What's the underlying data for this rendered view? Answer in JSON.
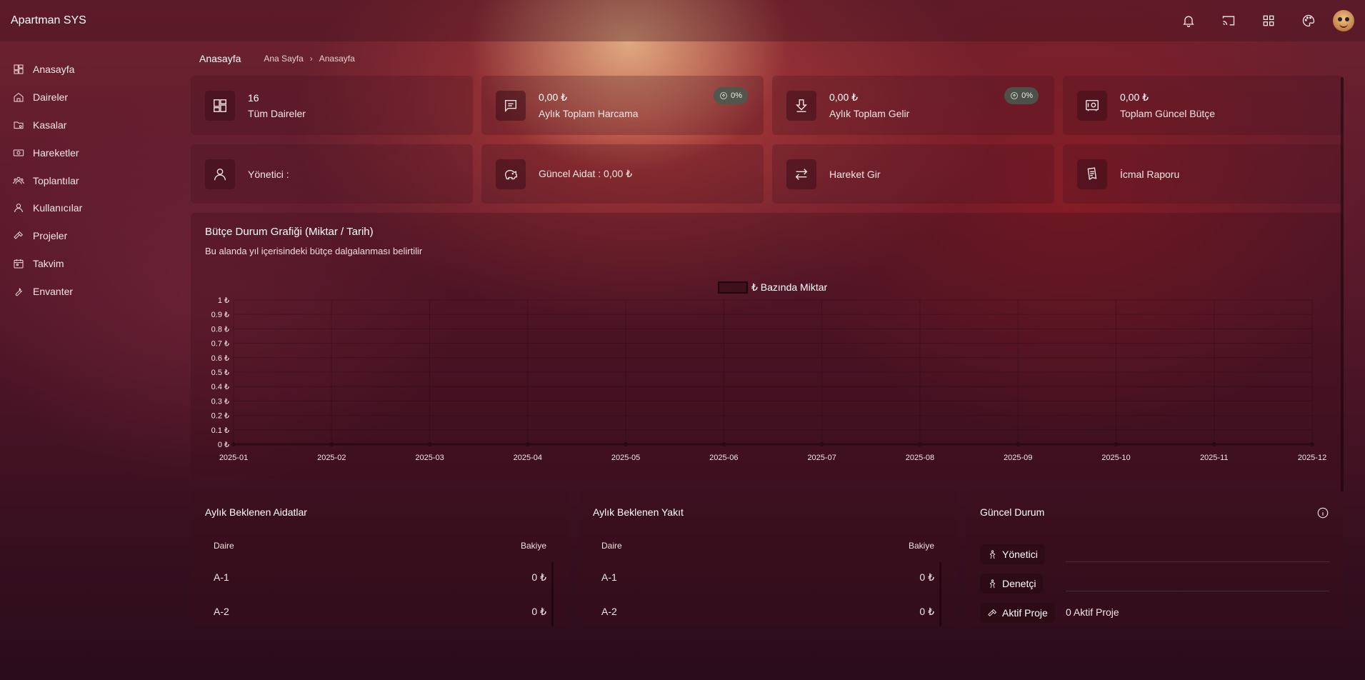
{
  "app": {
    "title": "Apartman SYS"
  },
  "topbar": {
    "icons": [
      "bell-icon",
      "cast-icon",
      "grid-icon",
      "palette-icon"
    ]
  },
  "sidebar": {
    "items": [
      {
        "label": "Anasayfa",
        "icon": "dashboard-icon"
      },
      {
        "label": "Daireler",
        "icon": "home-icon"
      },
      {
        "label": "Kasalar",
        "icon": "folder-icon"
      },
      {
        "label": "Hareketler",
        "icon": "money-icon"
      },
      {
        "label": "Toplantılar",
        "icon": "group-icon"
      },
      {
        "label": "Kullanıcılar",
        "icon": "user-icon"
      },
      {
        "label": "Projeler",
        "icon": "hammer-icon"
      },
      {
        "label": "Takvim",
        "icon": "calendar-icon"
      },
      {
        "label": "Envanter",
        "icon": "wrench-icon"
      }
    ]
  },
  "header": {
    "title": "Anasayfa",
    "breadcrumb": [
      "Ana Sayfa",
      "Anasayfa"
    ]
  },
  "stats": {
    "apartments": {
      "value": "16",
      "label": "Tüm Daireler"
    },
    "expense": {
      "value": "0,00 ₺",
      "label": "Aylık Toplam Harcama",
      "badge": "0%"
    },
    "income": {
      "value": "0,00 ₺",
      "label": "Aylık Toplam Gelir",
      "badge": "0%"
    },
    "budget": {
      "value": "0,00 ₺",
      "label": "Toplam Güncel Bütçe"
    }
  },
  "quick": {
    "manager": "Yönetici :",
    "dues": "Güncel Aidat : 0,00 ₺",
    "transaction": "Hareket Gir",
    "report": "İcmal Raporu"
  },
  "chart_panel": {
    "title": "Bütçe Durum Grafiği (Miktar / Tarih)",
    "subtitle": "Bu alanda yıl içerisindeki bütçe dalgalanması belirtilir"
  },
  "chart_data": {
    "type": "line",
    "series": [
      {
        "name": "₺ Bazında Miktar",
        "values": [
          0,
          0,
          0,
          0,
          0,
          0,
          0,
          0,
          0,
          0,
          0,
          0
        ]
      }
    ],
    "categories": [
      "2025-01",
      "2025-02",
      "2025-03",
      "2025-04",
      "2025-05",
      "2025-06",
      "2025-07",
      "2025-08",
      "2025-09",
      "2025-10",
      "2025-11",
      "2025-12"
    ],
    "yticks": [
      "0 ₺",
      "0.1 ₺",
      "0.2 ₺",
      "0.3 ₺",
      "0.4 ₺",
      "0.5 ₺",
      "0.6 ₺",
      "0.7 ₺",
      "0.8 ₺",
      "0.9 ₺",
      "1 ₺"
    ],
    "ylim": [
      0,
      1
    ],
    "grid": true,
    "legend": "top-center"
  },
  "dues_table": {
    "title": "Aylık Beklenen Aidatlar",
    "columns": [
      "Daire",
      "Bakiye"
    ],
    "rows": [
      {
        "daire": "A-1",
        "bakiye": "0 ₺"
      },
      {
        "daire": "A-2",
        "bakiye": "0 ₺"
      }
    ]
  },
  "fuel_table": {
    "title": "Aylık Beklenen Yakıt",
    "columns": [
      "Daire",
      "Bakiye"
    ],
    "rows": [
      {
        "daire": "A-1",
        "bakiye": "0 ₺"
      },
      {
        "daire": "A-2",
        "bakiye": "0 ₺"
      }
    ]
  },
  "status": {
    "title": "Güncel Durum",
    "manager_label": "Yönetici",
    "auditor_label": "Denetçi",
    "project_label": "Aktif Proje",
    "project_value": "0 Aktif Proje"
  }
}
